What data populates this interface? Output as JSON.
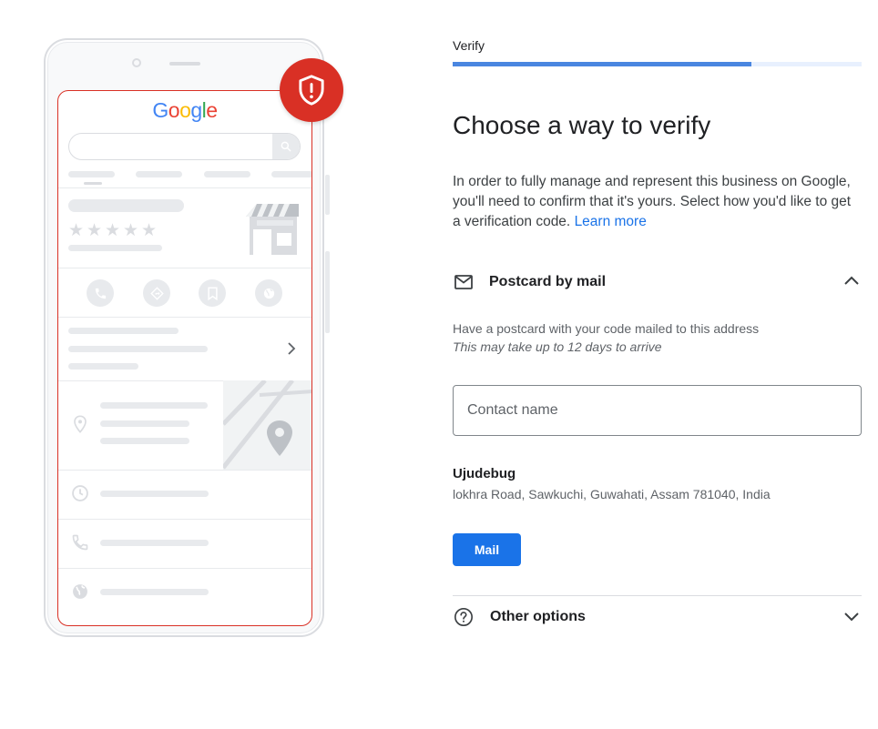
{
  "colors": {
    "primary_blue": "#1a73e8",
    "alert_red": "#d93025",
    "progress_fill": "#4a86e0",
    "progress_track": "#e8f0fe"
  },
  "illustration": {
    "logo_letters": [
      {
        "ch": "G",
        "color": "#4285f4"
      },
      {
        "ch": "o",
        "color": "#ea4335"
      },
      {
        "ch": "o",
        "color": "#fbbc05"
      },
      {
        "ch": "g",
        "color": "#4285f4"
      },
      {
        "ch": "l",
        "color": "#34a853"
      },
      {
        "ch": "e",
        "color": "#ea4335"
      }
    ],
    "rating_stars": 5,
    "badge_icon": "shield-alert-icon"
  },
  "step": {
    "label": "Verify",
    "progress": 0.73
  },
  "title": "Choose a way to verify",
  "intro": {
    "text": "In order to fully manage and represent this business on Google, you'll need to confirm that it's yours. Select how you'd like to get a verification code.",
    "link": "Learn more"
  },
  "postcard_section": {
    "icon": "mail-icon",
    "label": "Postcard by mail",
    "expanded": true,
    "description": "Have a postcard with your code mailed to this address",
    "note": "This may take up to 12 days to arrive",
    "contact_placeholder": "Contact name",
    "contact_value": "",
    "business_name": "Ujudebug",
    "address": "lokhra Road, Sawkuchi, Guwahati, Assam 781040, India",
    "button_label": "Mail"
  },
  "other_section": {
    "icon": "help-icon",
    "label": "Other options",
    "expanded": false
  }
}
